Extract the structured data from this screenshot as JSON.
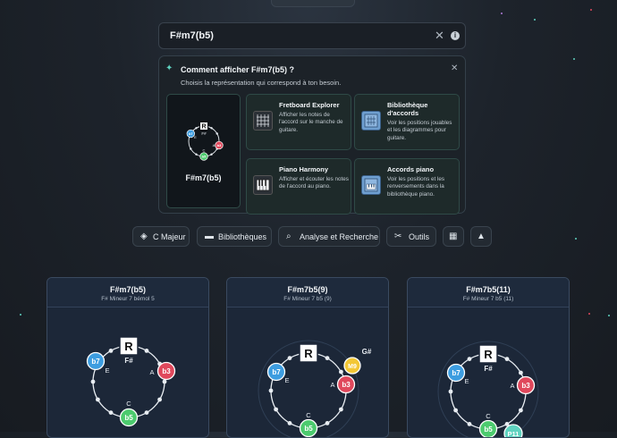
{
  "search": {
    "value": "F#m7(b5)"
  },
  "suggest": {
    "title": "Comment afficher F#m7(b5) ?",
    "subtitle": "Choisis la représentation qui correspond à ton besoin.",
    "chord_label": "F#m7(b5)",
    "options": [
      {
        "title": "Fretboard Explorer",
        "desc": "Afficher les notes de l'accord sur le manche de guitare."
      },
      {
        "title": "Bibliothèque d'accords",
        "desc": "Voir les positions jouables et les diagrammes pour guitare."
      },
      {
        "title": "Piano Harmony",
        "desc": "Afficher et écouter les notes de l'accord au piano."
      },
      {
        "title": "Accords piano",
        "desc": "Voir les positions et les renversements dans la bibliothèque piano."
      }
    ]
  },
  "toolbar": {
    "key": "C Majeur",
    "libraries": "Bibliothèques",
    "analysis": "Analyse et Recherche",
    "tools": "Outils"
  },
  "cards": [
    {
      "title": "F#m7(b5)",
      "subtitle": "F# Mineur 7 bémol 5"
    },
    {
      "title": "F#m7b5(9)",
      "subtitle": "F# Mineur 7 b5 (9)"
    },
    {
      "title": "F#m7b5(11)",
      "subtitle": "F# Mineur 7 b5 (11)"
    }
  ],
  "circle": {
    "root": "R",
    "root_note": "F#",
    "b7": "b7",
    "b7_note": "E",
    "b3": "b3",
    "b3_note": "A",
    "b5": "b5",
    "b5_note": "C",
    "nine": "M9",
    "nine_note": "G#",
    "eleven": "P11"
  },
  "colors": {
    "b7": "#3d9de0",
    "b3": "#e0485c",
    "b5": "#4ccb6e",
    "nine": "#f3c735",
    "eleven": "#5fd3c0",
    "accent": "#5fd3c0"
  }
}
